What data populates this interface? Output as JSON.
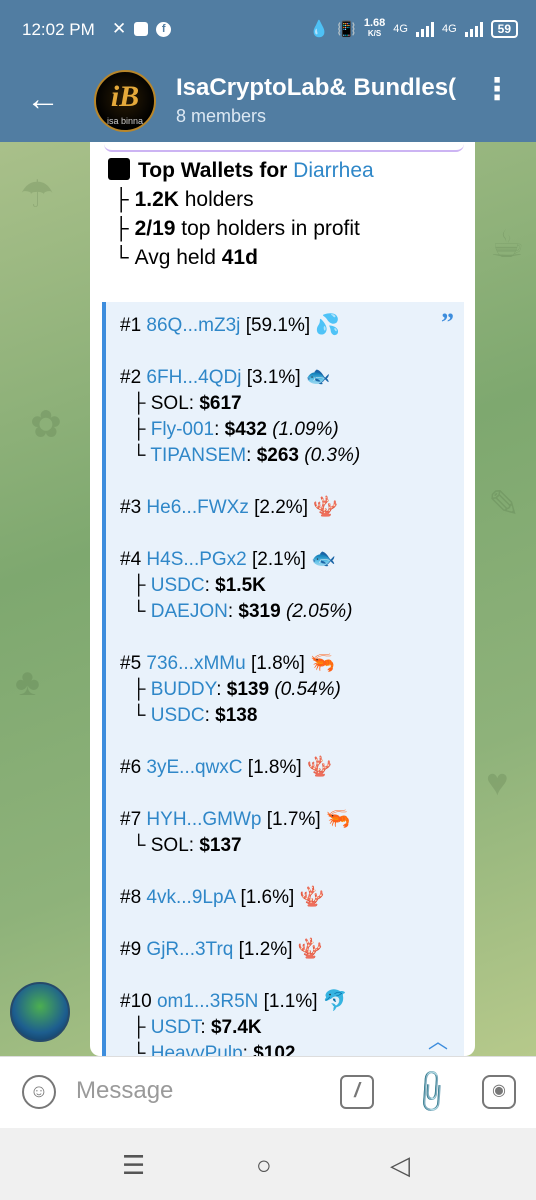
{
  "status_bar": {
    "time": "12:02 PM",
    "speed_value": "1.68",
    "speed_unit": "K/S",
    "net1": "4G",
    "net2": "4G",
    "battery": "59"
  },
  "header": {
    "title": "IsaCryptoLab& Bundles(",
    "members": "8 members",
    "avatar_text": "iB",
    "avatar_sub": "isa binna"
  },
  "message": {
    "summary": {
      "title_prefix": "Top Wallets for ",
      "token": "Diarrhea",
      "holders_value": "1.2K",
      "holders_label": " holders",
      "profit_value": "2/19",
      "profit_label": " top holders in profit",
      "avg_label": "Avg held ",
      "avg_value": "41d"
    },
    "wallets": [
      {
        "rank": "#1",
        "addr": "86Q...mZ3j",
        "pct": "[59.1%]",
        "emoji": "💦",
        "holdings": []
      },
      {
        "rank": "#2",
        "addr": "6FH...4QDj",
        "pct": "[3.1%]",
        "emoji": "🐟",
        "holdings": [
          {
            "branch": "├",
            "token": "SOL",
            "link": false,
            "value": "$617",
            "pct": ""
          },
          {
            "branch": "├",
            "token": "Fly-001",
            "link": true,
            "value": "$432",
            "pct": "(1.09%)"
          },
          {
            "branch": "└",
            "token": "TIPANSEM",
            "link": true,
            "value": "$263",
            "pct": "(0.3%)"
          }
        ]
      },
      {
        "rank": "#3",
        "addr": "He6...FWXz",
        "pct": "[2.2%]",
        "emoji": "🪸",
        "holdings": []
      },
      {
        "rank": "#4",
        "addr": "H4S...PGx2",
        "pct": "[2.1%]",
        "emoji": "🐟",
        "holdings": [
          {
            "branch": "├",
            "token": "USDC",
            "link": true,
            "value": "$1.5K",
            "pct": ""
          },
          {
            "branch": "└",
            "token": "DAEJON",
            "link": true,
            "value": "$319",
            "pct": "(2.05%)"
          }
        ]
      },
      {
        "rank": "#5",
        "addr": "736...xMMu",
        "pct": "[1.8%]",
        "emoji": "🦐",
        "holdings": [
          {
            "branch": "├",
            "token": "BUDDY",
            "link": true,
            "value": "$139",
            "pct": "(0.54%)"
          },
          {
            "branch": "└",
            "token": "USDC",
            "link": true,
            "value": "$138",
            "pct": ""
          }
        ]
      },
      {
        "rank": "#6",
        "addr": "3yE...qwxC",
        "pct": "[1.8%]",
        "emoji": "🪸",
        "holdings": []
      },
      {
        "rank": "#7",
        "addr": "HYH...GMWp",
        "pct": "[1.7%]",
        "emoji": "🦐",
        "holdings": [
          {
            "branch": "└",
            "token": "SOL",
            "link": false,
            "value": "$137",
            "pct": ""
          }
        ]
      },
      {
        "rank": "#8",
        "addr": "4vk...9LpA",
        "pct": "[1.6%]",
        "emoji": "🪸",
        "holdings": []
      },
      {
        "rank": "#9",
        "addr": "GjR...3Trq",
        "pct": "[1.2%]",
        "emoji": "🪸",
        "holdings": []
      },
      {
        "rank": "#10",
        "addr": "om1...3R5N",
        "pct": "[1.1%]",
        "emoji": "🐬",
        "holdings": [
          {
            "branch": "├",
            "token": "USDT",
            "link": true,
            "value": "$7.4K",
            "pct": ""
          },
          {
            "branch": "└",
            "token": "HeavyPulp",
            "link": true,
            "value": "$102",
            "pct": ""
          }
        ]
      }
    ]
  },
  "composer": {
    "placeholder": "Message"
  },
  "colors": {
    "header_bg": "#517da2",
    "link": "#2f87c8",
    "quote_bar": "#3d8ddd",
    "quote_bg": "#e9f2fb"
  }
}
